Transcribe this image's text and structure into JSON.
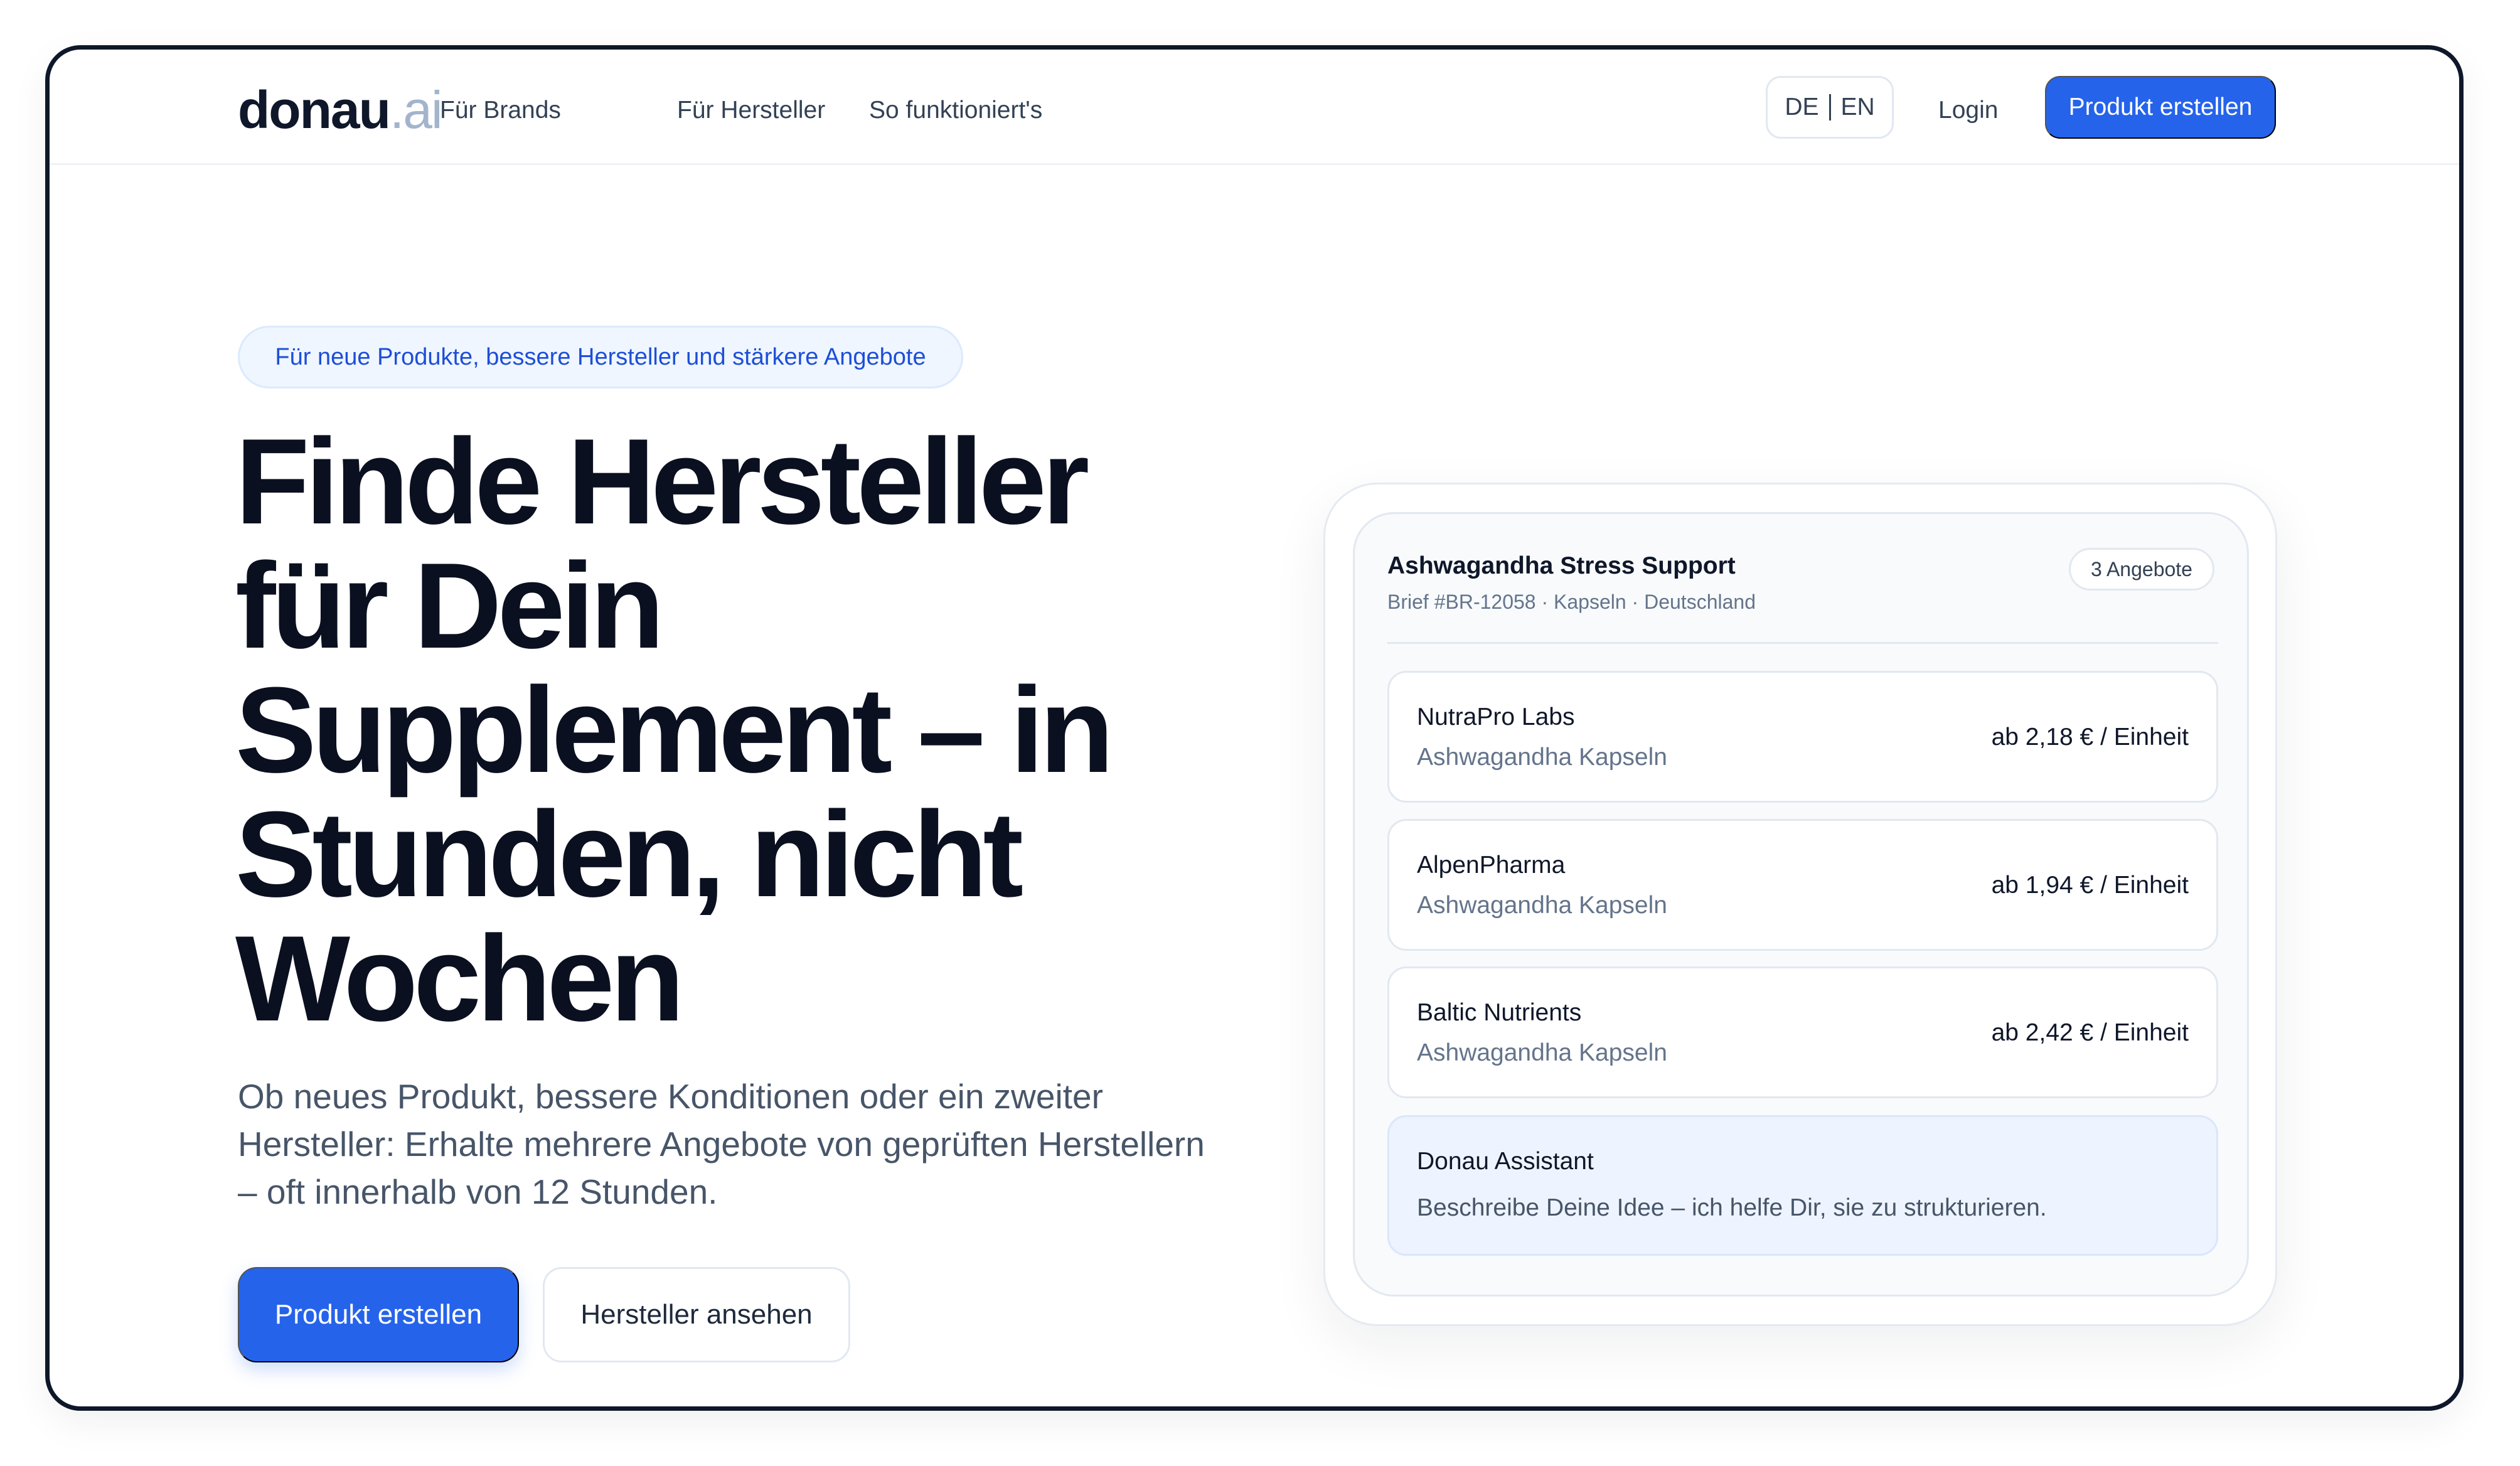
{
  "nav": {
    "logo_main": "donau",
    "logo_suffix": ".ai",
    "links": [
      "Für Brands",
      "Für Hersteller",
      "So funktioniert's"
    ],
    "lang_de": "DE",
    "lang_en": "EN",
    "login": "Login",
    "cta": "Produkt erstellen"
  },
  "hero": {
    "badge": "Für neue Produkte, bessere Hersteller und stärkere Angebote",
    "headline_lines": [
      "Finde Hersteller",
      "für Dein",
      "Supplement – in",
      "Stunden, nicht",
      "Wochen"
    ],
    "subtext": "Ob neues Produkt, bessere Konditionen oder ein zweiter Hersteller: Erhalte mehrere Angebote von geprüften Herstellern – oft innerhalb von 12 Stunden.",
    "primary_button": "Produkt erstellen",
    "secondary_button": "Hersteller ansehen"
  },
  "card": {
    "title": "Ashwagandha Stress Support",
    "meta": "Brief #BR-12058 · Kapseln · Deutschland",
    "offers_count": "3 Angebote",
    "offers": [
      {
        "name": "NutraPro Labs",
        "product": "Ashwagandha Kapseln",
        "price": "ab 2,18 € / Einheit"
      },
      {
        "name": "AlpenPharma",
        "product": "Ashwagandha Kapseln",
        "price": "ab 1,94 € / Einheit"
      },
      {
        "name": "Baltic Nutrients",
        "product": "Ashwagandha Kapseln",
        "price": "ab 2,42 € / Einheit"
      }
    ],
    "assistant_title": "Donau Assistant",
    "assistant_text": "Beschreibe Deine Idee – ich helfe Dir, sie zu strukturieren."
  },
  "colors": {
    "accent": "#2563eb",
    "text_dark": "#0b1020",
    "text_muted": "#64748b",
    "frame_border": "#0f172a"
  }
}
